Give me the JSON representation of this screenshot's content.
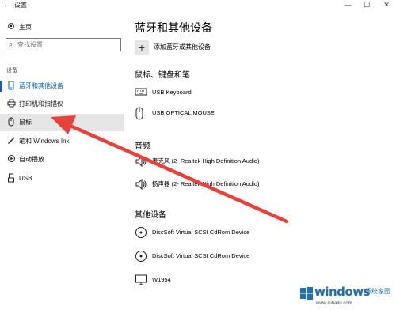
{
  "window": {
    "title": "设置",
    "back_icon": "back-arrow-icon"
  },
  "window_controls": {
    "minimize": "—",
    "maximize": "☐",
    "close": "✕"
  },
  "sidebar": {
    "home_label": "主页",
    "search_placeholder": "查找设置",
    "section_label": "设备",
    "items": [
      {
        "label": "蓝牙和其他设备",
        "icon": "bluetooth-devices-icon",
        "active": true
      },
      {
        "label": "打印机和扫描仪",
        "icon": "printer-icon"
      },
      {
        "label": "鼠标",
        "icon": "mouse-icon",
        "hover": true
      },
      {
        "label": "笔和 Windows Ink",
        "icon": "pen-icon"
      },
      {
        "label": "自动播放",
        "icon": "autoplay-icon"
      },
      {
        "label": "USB",
        "icon": "usb-icon"
      }
    ]
  },
  "main": {
    "title": "蓝牙和其他设备",
    "add_device_label": "添加蓝牙或其他设备",
    "groups": [
      {
        "title": "鼠标、键盘和笔",
        "devices": [
          {
            "name": "USB Keyboard",
            "icon": "keyboard-icon"
          },
          {
            "name": "USB OPTICAL MOUSE",
            "icon": "mouse-icon"
          }
        ]
      },
      {
        "title": "音频",
        "devices": [
          {
            "name": "麦克风 (2- Realtek High Definition Audio)",
            "icon": "speaker-icon"
          },
          {
            "name": "扬声器 (2- Realtek High Definition Audio)",
            "icon": "speaker-icon"
          }
        ]
      },
      {
        "title": "其他设备",
        "devices": [
          {
            "name": "DiscSoft Virtual SCSI CdRom Device",
            "icon": "disc-icon"
          },
          {
            "name": "DiscSoft Virtual SCSI CdRom Device",
            "icon": "disc-icon"
          },
          {
            "name": "W1954",
            "icon": "monitor-icon"
          }
        ]
      }
    ]
  },
  "annotation": {
    "arrow_color": "#e8403a"
  },
  "watermark": {
    "brand": "windows",
    "site": "系统家园",
    "url": "www.ruhaitu.com"
  },
  "colors": {
    "accent": "#0067c0",
    "hover_bg": "#e6e6e6",
    "watermark_blue": "#1f6fb5"
  }
}
